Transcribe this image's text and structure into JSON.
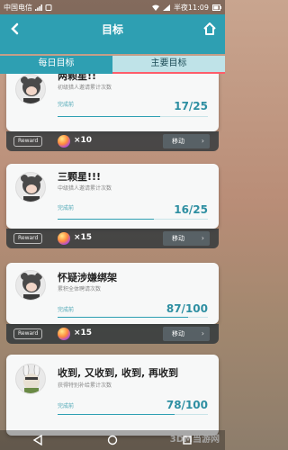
{
  "status": {
    "carrier": "中国电信",
    "time": "半夜11:09"
  },
  "header": {
    "title": "目标",
    "tabs": [
      "每日目标",
      "主要目标"
    ]
  },
  "goals": [
    {
      "name": "两颗星!!",
      "desc": "初级猎人邀请累计次数",
      "done_label": "完成前",
      "progress": "17/25",
      "progress_fraction": 0.68,
      "reward_label": "Reward",
      "reward_count": "×10",
      "move_label": "移动"
    },
    {
      "name": "三颗星!!!",
      "desc": "中级猎人邀请累计次数",
      "done_label": "完成前",
      "progress": "16/25",
      "progress_fraction": 0.64,
      "reward_label": "Reward",
      "reward_count": "×15",
      "move_label": "移动"
    },
    {
      "name": "怀疑涉嫌绑架",
      "desc": "累积全体聘请次数",
      "done_label": "完成前",
      "progress": "87/100",
      "progress_fraction": 0.87,
      "reward_label": "Reward",
      "reward_count": "×15",
      "move_label": "移动"
    },
    {
      "name": "收到, 又收到, 收到, 再收到",
      "desc": "获得特别补给累计次数",
      "done_label": "完成前",
      "progress": "78/100",
      "progress_fraction": 0.78
    }
  ],
  "watermark": "3DM当游网",
  "colors": {
    "header": "#2e9fb2",
    "tab_active_underline": "#ff5d6a",
    "progress_text": "#2e8fa2"
  }
}
